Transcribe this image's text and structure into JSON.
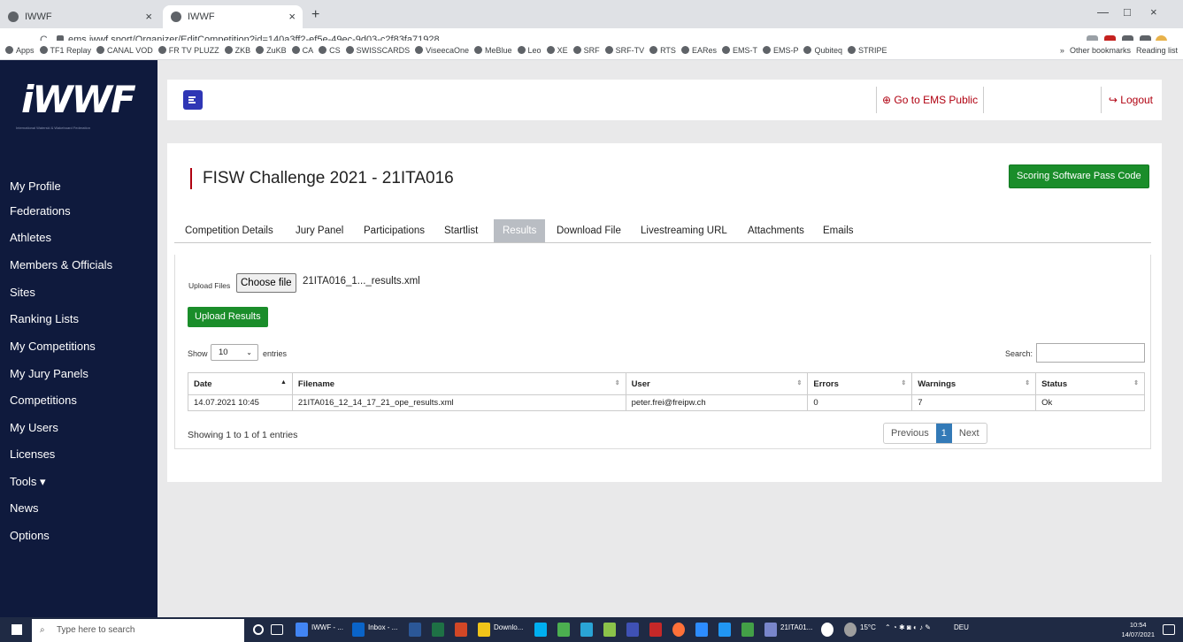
{
  "browser": {
    "tabs": [
      {
        "title": "IWWF",
        "close": "×"
      },
      {
        "title": "IWWF",
        "close": "×"
      }
    ],
    "new_tab": "+",
    "window_controls": [
      "—",
      "□",
      "×"
    ],
    "url": "ems.iwwf.sport/Organizer/EditCompetition?id=140a3ff2-ef5e-49ec-9d03-c2f83fa71928",
    "nav": {
      "back": "←",
      "forward": "→",
      "reload": "C"
    },
    "bookmarks": [
      "Apps",
      "TF1 Replay",
      "CANAL VOD",
      "FR TV PLUZZ",
      "ZKB",
      "ZuKB",
      "CA",
      "CS",
      "SWISSCARDS",
      "ViseecaOne",
      "MeBlue",
      "Leo",
      "XE",
      "SRF",
      "SRF-TV",
      "RTS",
      "EARes",
      "EMS-T",
      "EMS-P",
      "Qubiteq",
      "STRIPE"
    ],
    "bookmarks_more": "»",
    "other_bookmarks": "Other bookmarks",
    "reading_list": "Reading list"
  },
  "sidebar": {
    "logo_text": "iWWF",
    "logo_tagline": "International Waterski & Wakeboard Federation",
    "items": [
      "My Profile",
      "Federations",
      "Athletes",
      "Members & Officials",
      "Sites",
      "Ranking Lists",
      "My Competitions",
      "My Jury Panels",
      "Competitions",
      "My Users",
      "Licenses",
      "Tools ▾",
      "News",
      "Options"
    ]
  },
  "header": {
    "ems_public": "Go to EMS Public",
    "logout": "Logout"
  },
  "page": {
    "title": "FISW Challenge 2021 - 21ITA016",
    "pass_code_button": "Scoring Software Pass Code",
    "tabs": [
      "Competition Details",
      "Jury Panel",
      "Participations",
      "Startlist",
      "Results",
      "Download File",
      "Livestreaming URL",
      "Attachments",
      "Emails"
    ],
    "active_tab": "Results"
  },
  "upload": {
    "label": "Upload Files",
    "choose_file": "Choose file",
    "chosen_file": "21ITA016_1..._results.xml",
    "button": "Upload Results"
  },
  "table": {
    "show": "Show",
    "entries_value": "10",
    "entries": "entries",
    "search": "Search:",
    "columns": [
      "Date",
      "Filename",
      "User",
      "Errors",
      "Warnings",
      "Status"
    ],
    "rows": [
      [
        "14.07.2021 10:45",
        "21ITA016_12_14_17_21_ope_results.xml",
        "peter.frei@freipw.ch",
        "0",
        "7",
        "Ok"
      ]
    ],
    "info": "Showing 1 to 1 of 1 entries",
    "pager": {
      "previous": "Previous",
      "current": "1",
      "next": "Next"
    }
  },
  "taskbar": {
    "search_placeholder": "Type here to search",
    "apps": [
      "IWWF - ...",
      "Inbox - ...",
      "Downlo...",
      "21ITA01..."
    ],
    "weather": "15°C",
    "lang": "DEU",
    "time": "10:54",
    "date": "14/07/2021"
  }
}
